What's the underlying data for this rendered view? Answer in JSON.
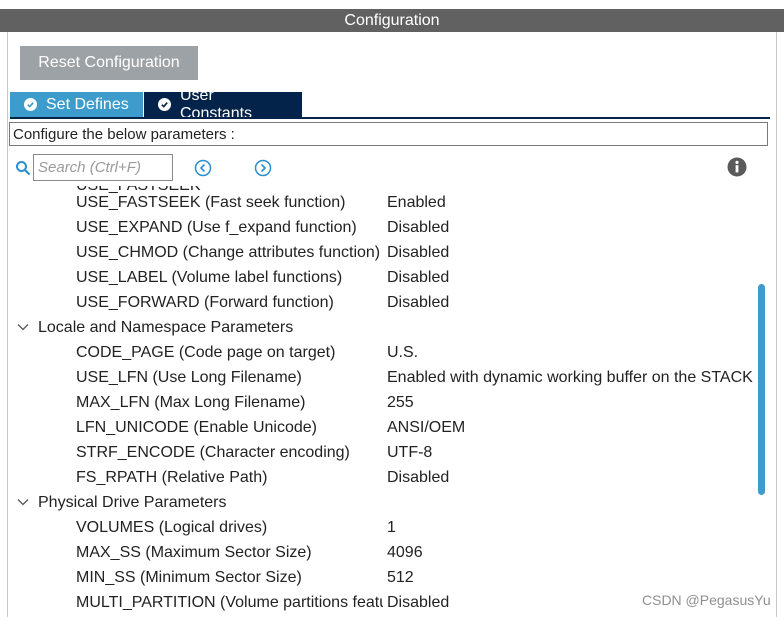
{
  "header": {
    "title": "Configuration"
  },
  "toolbar": {
    "reset_label": "Reset Configuration"
  },
  "tabs": [
    {
      "label": "Set Defines"
    },
    {
      "label": "User Constants"
    }
  ],
  "configure_text": "Configure the below parameters :",
  "search": {
    "placeholder": "Search (Ctrl+F)"
  },
  "icons": {
    "search": "search-icon",
    "prev": "circle-left-icon",
    "next": "circle-right-icon",
    "info": "info-icon",
    "check": "check-icon",
    "expand": "chevron-down-icon"
  },
  "partial_row": "USE_FASTSEEK",
  "rows": [
    {
      "name": "USE_FASTSEEK (Fast seek function)",
      "value": "Enabled"
    },
    {
      "name": "USE_EXPAND (Use f_expand function)",
      "value": "Disabled"
    },
    {
      "name": "USE_CHMOD (Change attributes function)",
      "value": "Disabled"
    },
    {
      "name": "USE_LABEL (Volume label functions)",
      "value": "Disabled"
    },
    {
      "name": "USE_FORWARD (Forward function)",
      "value": "Disabled"
    },
    {
      "group": "Locale and Namespace Parameters"
    },
    {
      "name": "CODE_PAGE (Code page on target)",
      "value": "U.S."
    },
    {
      "name": "USE_LFN (Use Long Filename)",
      "value": "Enabled with dynamic working buffer on the STACK"
    },
    {
      "name": "MAX_LFN (Max Long Filename)",
      "value": "255"
    },
    {
      "name": "LFN_UNICODE (Enable Unicode)",
      "value": "ANSI/OEM"
    },
    {
      "name": "STRF_ENCODE (Character encoding)",
      "value": "UTF-8"
    },
    {
      "name": "FS_RPATH (Relative Path)",
      "value": "Disabled"
    },
    {
      "group": "Physical Drive Parameters"
    },
    {
      "name": "VOLUMES (Logical drives)",
      "value": "1"
    },
    {
      "name": "MAX_SS (Maximum Sector Size)",
      "value": "4096"
    },
    {
      "name": "MIN_SS (Minimum Sector Size)",
      "value": "512"
    },
    {
      "name": "MULTI_PARTITION (Volume partitions feature)",
      "value": "Disabled"
    }
  ],
  "watermark": "CSDN @PegasusYu",
  "colors": {
    "title_bar": "#616161",
    "tab_active": "#3d9ccc",
    "tab_dark": "#03234b",
    "button": "#9da2a6",
    "scroll_thumb": "#3d9ccc"
  }
}
